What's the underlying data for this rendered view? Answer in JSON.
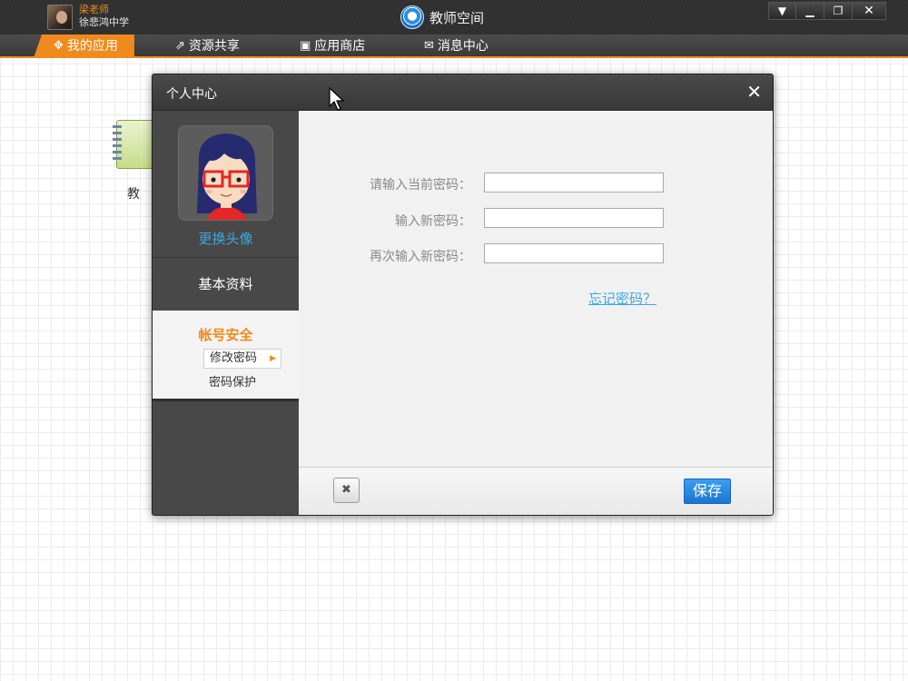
{
  "titlebar": {
    "user_name": "梁老师",
    "user_school": "徐悲鸿中学",
    "app_title": "教师空间",
    "window_buttons": [
      "▼",
      "▁",
      "❐",
      "✕"
    ]
  },
  "nav": {
    "items": [
      {
        "label": "我的应用",
        "icon": "apps-icon",
        "glyph": "✥",
        "active": true
      },
      {
        "label": "资源共享",
        "icon": "share-icon",
        "glyph": "⇗",
        "active": false
      },
      {
        "label": "应用商店",
        "icon": "store-icon",
        "glyph": "▣",
        "active": false
      },
      {
        "label": "消息中心",
        "icon": "message-icon",
        "glyph": "✉",
        "active": false
      }
    ]
  },
  "desktop": {
    "icon_label": "教"
  },
  "dialog": {
    "title": "个人中心",
    "close_glyph": "✕",
    "sidebar": {
      "change_avatar": "更换头像",
      "basic_info": "基本资料",
      "account_security": "帐号安全",
      "change_password": "修改密码",
      "password_protection": "密码保护"
    },
    "form": {
      "current_password_label": "请输入当前密码：",
      "current_password_value": "",
      "new_password_label": "输入新密码：",
      "new_password_value": "",
      "confirm_password_label": "再次输入新密码：",
      "confirm_password_value": "",
      "forgot_password": "忘记密码？"
    },
    "footer": {
      "cancel_glyph": "✖",
      "save_label": "保存"
    }
  },
  "colors": {
    "accent": "#f08a1c",
    "link": "#3ea7e0",
    "save_button": "#1a76d2"
  }
}
